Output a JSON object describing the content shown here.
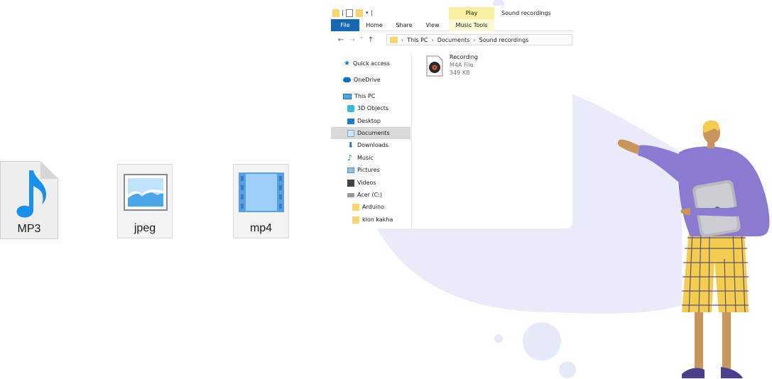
{
  "colors": {
    "blob": "#e9ebf8",
    "dots": "#e6e9f7",
    "file_tab": "#1966b9",
    "play_tab": "#f7f1a1",
    "music_tools_tab": "#fbf8d6",
    "mp3_accent": "#1890f0",
    "sweater": "#8a7bd0",
    "pants": "#f4cd4e"
  },
  "file_icons": [
    {
      "label": "MP3",
      "icon": "music-note-icon"
    },
    {
      "label": "jpeg",
      "icon": "image-icon"
    },
    {
      "label": "mp4",
      "icon": "film-icon"
    }
  ],
  "explorer": {
    "contextual_tab": "Play",
    "window_title": "Sound recordings",
    "ribbon_tabs": [
      "File",
      "Home",
      "Share",
      "View",
      "Music Tools"
    ],
    "breadcrumb": [
      "This PC",
      "Documents",
      "Sound recordings"
    ],
    "nav_items": [
      {
        "label": "Quick access",
        "icon": "star-icon"
      },
      {
        "label": "OneDrive",
        "icon": "cloud-icon"
      },
      {
        "label": "This PC",
        "icon": "monitor-icon"
      },
      {
        "label": "3D Objects",
        "icon": "cube-icon"
      },
      {
        "label": "Desktop",
        "icon": "desktop-icon"
      },
      {
        "label": "Documents",
        "icon": "document-icon",
        "selected": true
      },
      {
        "label": "Downloads",
        "icon": "download-arrow-icon"
      },
      {
        "label": "Music",
        "icon": "music-note-icon"
      },
      {
        "label": "Pictures",
        "icon": "picture-icon"
      },
      {
        "label": "Videos",
        "icon": "video-icon"
      },
      {
        "label": "Acer (C:)",
        "icon": "drive-icon"
      },
      {
        "label": "Arduino",
        "icon": "folder-icon"
      },
      {
        "label": "klon kakha",
        "icon": "folder-icon"
      }
    ],
    "file": {
      "name": "Recording",
      "type": "M4A File",
      "size": "349 KB",
      "icon": "audio-file-icon"
    }
  }
}
